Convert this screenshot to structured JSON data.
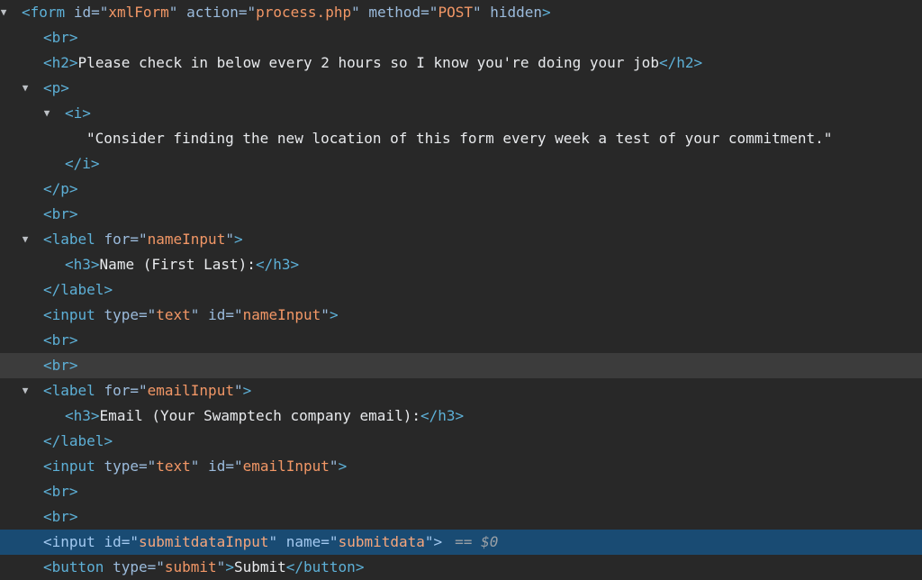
{
  "panel": "Elements",
  "colors": {
    "background": "#282828",
    "tag": "#5db0d7",
    "attribute_name": "#9bbbdc",
    "attribute_value": "#f29766",
    "text": "#e8eaed",
    "hover_row": "#3c3c3c",
    "selected_row": "#194b73"
  },
  "selected_node_marker": "== $0",
  "nodes": [
    {
      "depth": 0,
      "expanded": true,
      "kind": "open",
      "tag": "form",
      "attrs": [
        {
          "name": "id",
          "value": "xmlForm"
        },
        {
          "name": "action",
          "value": "process.php"
        },
        {
          "name": "method",
          "value": "POST"
        },
        {
          "name": "hidden",
          "value": null
        }
      ]
    },
    {
      "depth": 1,
      "kind": "open",
      "tag": "br",
      "attrs": []
    },
    {
      "depth": 1,
      "kind": "element",
      "tag": "h2",
      "attrs": [],
      "text": "Please check in below every 2 hours so I know you're doing your job"
    },
    {
      "depth": 1,
      "expanded": true,
      "kind": "open",
      "tag": "p",
      "attrs": []
    },
    {
      "depth": 2,
      "expanded": true,
      "kind": "open",
      "tag": "i",
      "attrs": []
    },
    {
      "depth": 3,
      "kind": "text",
      "text": "\"Consider finding the new location of this form every week a test of your commitment.\""
    },
    {
      "depth": 2,
      "kind": "close",
      "tag": "i"
    },
    {
      "depth": 1,
      "kind": "close",
      "tag": "p"
    },
    {
      "depth": 1,
      "kind": "open",
      "tag": "br",
      "attrs": []
    },
    {
      "depth": 1,
      "expanded": true,
      "kind": "open",
      "tag": "label",
      "attrs": [
        {
          "name": "for",
          "value": "nameInput"
        }
      ]
    },
    {
      "depth": 2,
      "kind": "element",
      "tag": "h3",
      "attrs": [],
      "text": "Name (First Last):"
    },
    {
      "depth": 1,
      "kind": "close",
      "tag": "label"
    },
    {
      "depth": 1,
      "kind": "open",
      "tag": "input",
      "attrs": [
        {
          "name": "type",
          "value": "text"
        },
        {
          "name": "id",
          "value": "nameInput"
        }
      ]
    },
    {
      "depth": 1,
      "kind": "open",
      "tag": "br",
      "attrs": []
    },
    {
      "depth": 1,
      "kind": "open",
      "tag": "br",
      "attrs": [],
      "state": "hover"
    },
    {
      "depth": 1,
      "expanded": true,
      "kind": "open",
      "tag": "label",
      "attrs": [
        {
          "name": "for",
          "value": "emailInput"
        }
      ]
    },
    {
      "depth": 2,
      "kind": "element",
      "tag": "h3",
      "attrs": [],
      "text": "Email (Your Swamptech company email):"
    },
    {
      "depth": 1,
      "kind": "close",
      "tag": "label"
    },
    {
      "depth": 1,
      "kind": "open",
      "tag": "input",
      "attrs": [
        {
          "name": "type",
          "value": "text"
        },
        {
          "name": "id",
          "value": "emailInput"
        }
      ]
    },
    {
      "depth": 1,
      "kind": "open",
      "tag": "br",
      "attrs": []
    },
    {
      "depth": 1,
      "kind": "open",
      "tag": "br",
      "attrs": []
    },
    {
      "depth": 1,
      "kind": "open",
      "tag": "input",
      "attrs": [
        {
          "name": "id",
          "value": "submitdataInput"
        },
        {
          "name": "name",
          "value": "submitdata"
        }
      ],
      "state": "selected"
    },
    {
      "depth": 1,
      "kind": "element",
      "tag": "button",
      "attrs": [
        {
          "name": "type",
          "value": "submit"
        }
      ],
      "text": "Submit"
    }
  ]
}
